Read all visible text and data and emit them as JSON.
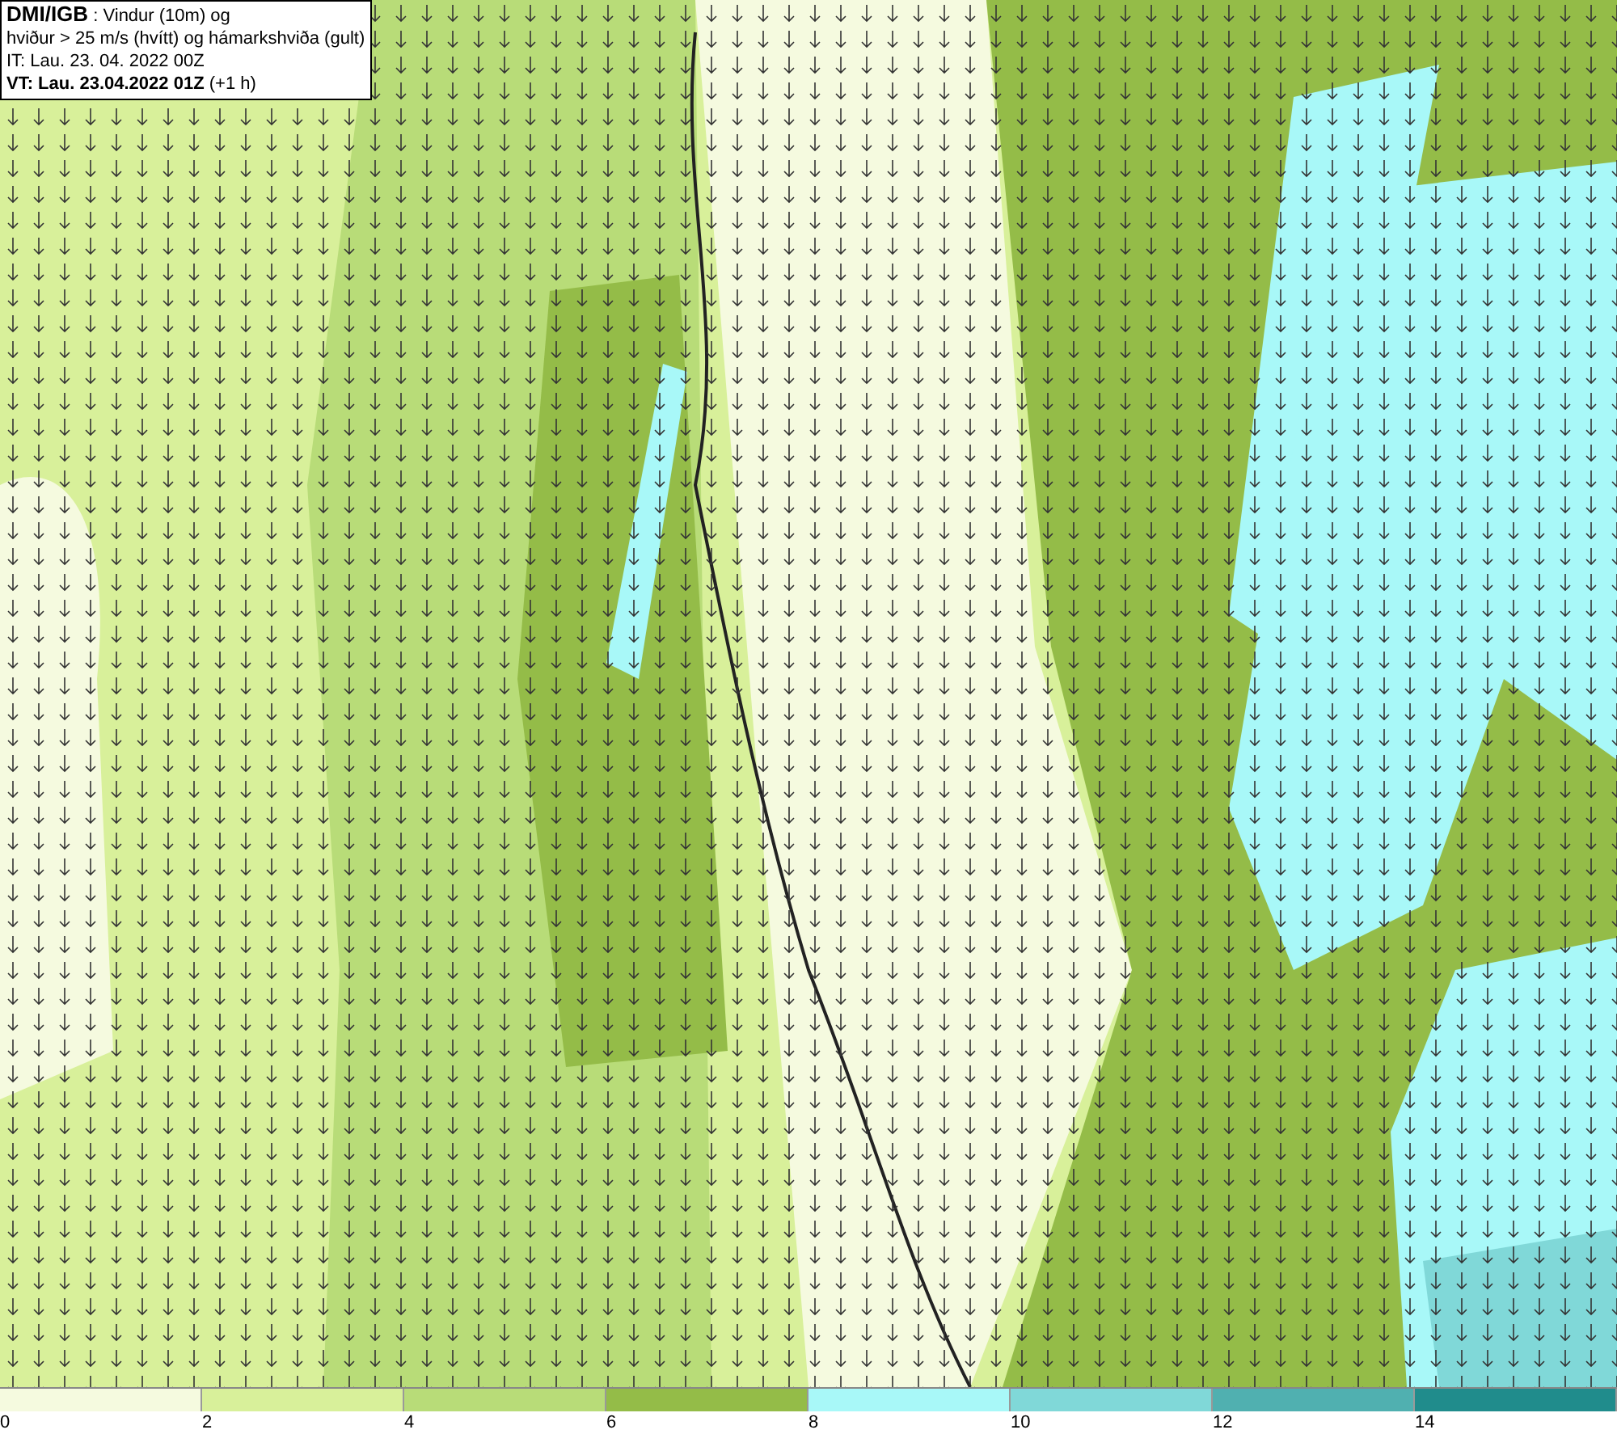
{
  "header": {
    "lines": [
      "**DMI/IGB** : Vindur (10m) og",
      "hviður > 25 m/s (hvítt) og hámarkshviða (gult)",
      "IT: Lau. 23. 04. 2022 00Z",
      "**VT: Lau. 23.04.2022 01Z** (+1 h)"
    ]
  },
  "legend": {
    "bins": [
      {
        "color": "#f5fadf"
      },
      {
        "color": "#d8f09a"
      },
      {
        "color": "#b8dc78"
      },
      {
        "color": "#94bc48"
      },
      {
        "color": "#a8f8f8"
      },
      {
        "color": "#80d8d8"
      },
      {
        "color": "#50b0b0"
      },
      {
        "color": "#208c8c"
      }
    ],
    "ticks": [
      "0",
      "2",
      "4",
      "6",
      "8",
      "10",
      "12",
      "14"
    ]
  }
}
